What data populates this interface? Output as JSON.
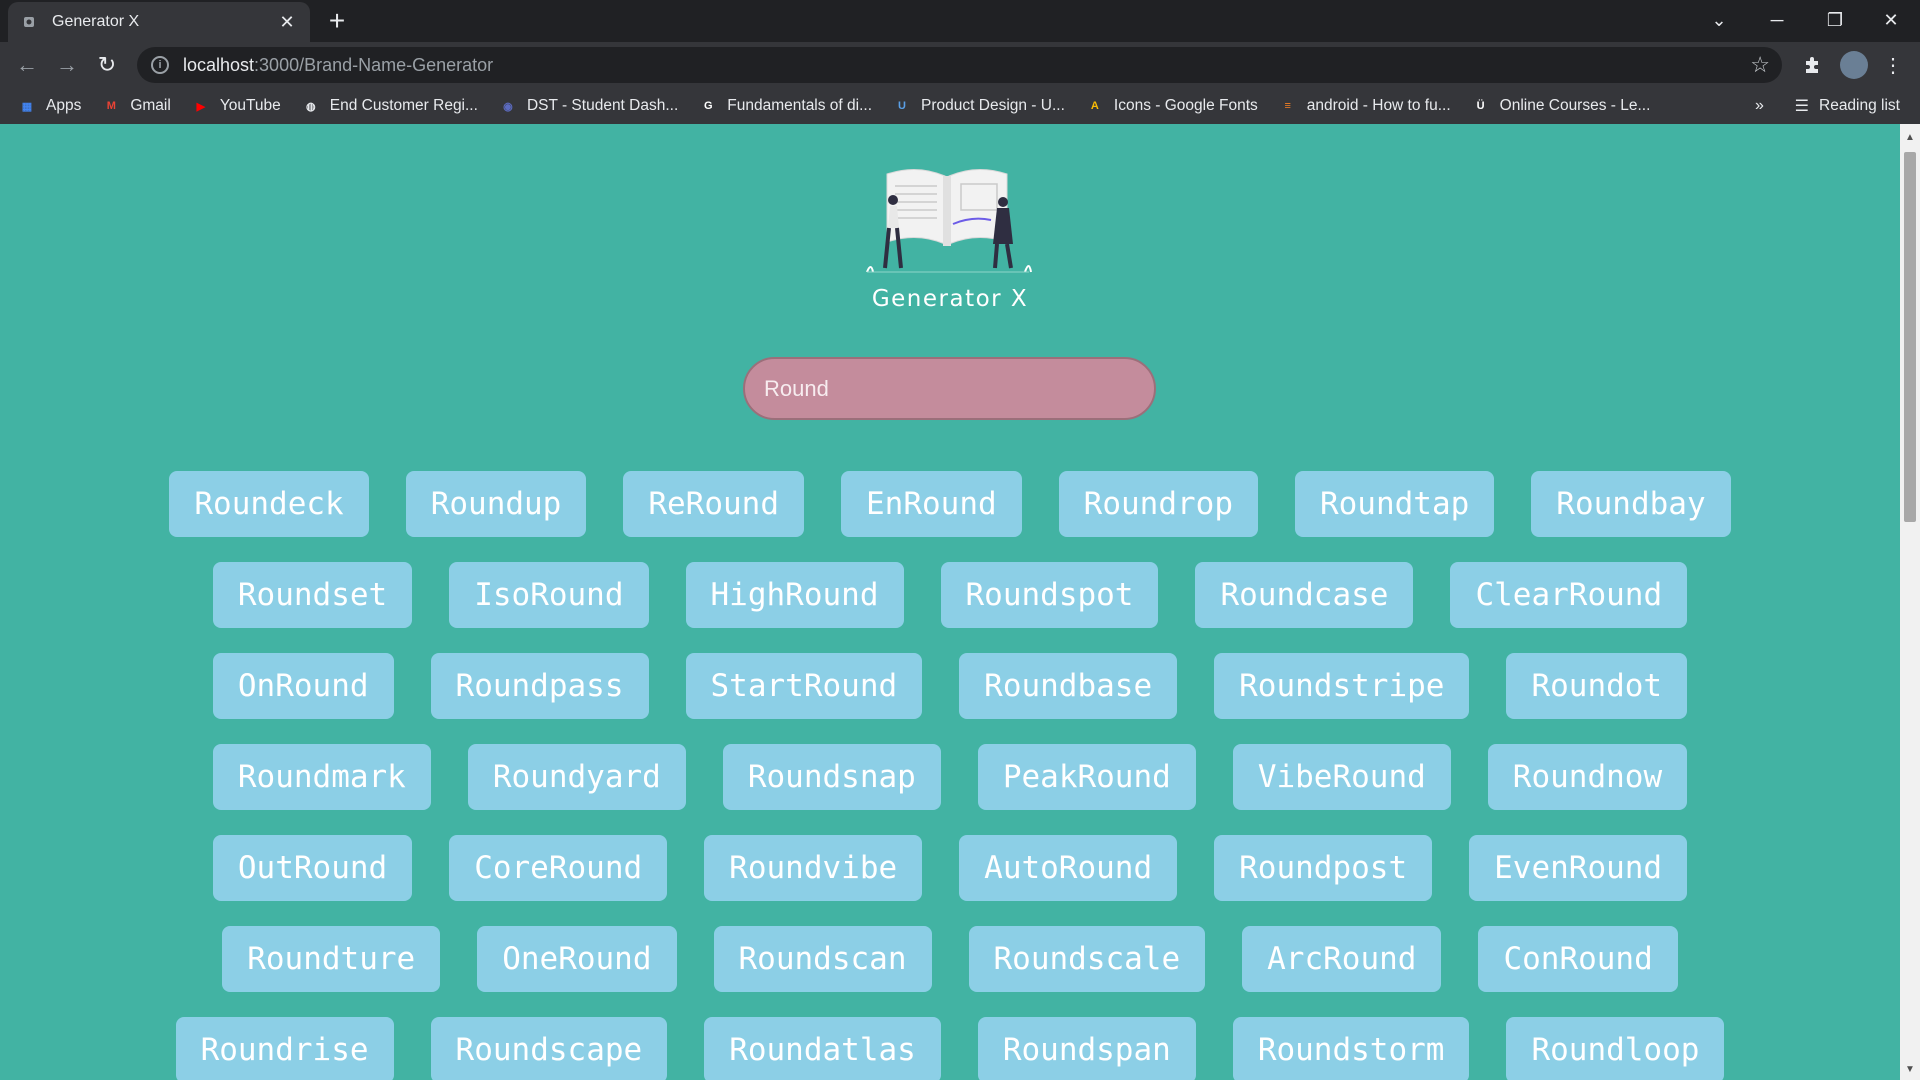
{
  "browser": {
    "tab_title": "Generator X",
    "url_host": "localhost",
    "url_path": ":3000/Brand-Name-Generator",
    "bookmarks": [
      {
        "label": "Apps",
        "icon": "apps-grid-icon",
        "color": "#4285f4"
      },
      {
        "label": "Gmail",
        "icon": "gmail-icon",
        "color": "#ea4335"
      },
      {
        "label": "YouTube",
        "icon": "youtube-icon",
        "color": "#ff0000"
      },
      {
        "label": "End Customer Regi...",
        "icon": "globe-icon",
        "color": "#e8eaed"
      },
      {
        "label": "DST - Student Dash...",
        "icon": "dst-icon",
        "color": "#5c6bc0"
      },
      {
        "label": "Fundamentals of di...",
        "icon": "google-icon",
        "color": "#ffffff"
      },
      {
        "label": "Product Design - U...",
        "icon": "udemy-icon",
        "color": "#5aa0e6"
      },
      {
        "label": "Icons - Google Fonts",
        "icon": "google-fonts-icon",
        "color": "#fbbc04"
      },
      {
        "label": "android - How to fu...",
        "icon": "stackoverflow-icon",
        "color": "#f48024"
      },
      {
        "label": "Online Courses - Le...",
        "icon": "udemy-u-icon",
        "color": "#ffffff"
      }
    ],
    "reading_list": "Reading list",
    "overflow": "»"
  },
  "app": {
    "title": "Generator X",
    "search_value": "Round"
  },
  "names": [
    [
      "Roundeck",
      "Roundup",
      "ReRound",
      "EnRound",
      "Roundrop",
      "Roundtap",
      "Roundbay"
    ],
    [
      "Roundset",
      "IsoRound",
      "HighRound",
      "Roundspot",
      "Roundcase",
      "ClearRound"
    ],
    [
      "OnRound",
      "Roundpass",
      "StartRound",
      "Roundbase",
      "Roundstripe",
      "Roundot"
    ],
    [
      "Roundmark",
      "Roundyard",
      "Roundsnap",
      "PeakRound",
      "VibeRound",
      "Roundnow"
    ],
    [
      "OutRound",
      "CoreRound",
      "Roundvibe",
      "AutoRound",
      "Roundpost",
      "EvenRound"
    ],
    [
      "Roundture",
      "OneRound",
      "Roundscan",
      "Roundscale",
      "ArcRound",
      "ConRound"
    ],
    [
      "Roundrise",
      "Roundscape",
      "Roundatlas",
      "Roundspan",
      "Roundstorm",
      "Roundloop"
    ]
  ],
  "colors": {
    "page_bg": "#42b3a3",
    "card_bg": "#8ccfe6",
    "search_bg": "#c48c9c"
  }
}
